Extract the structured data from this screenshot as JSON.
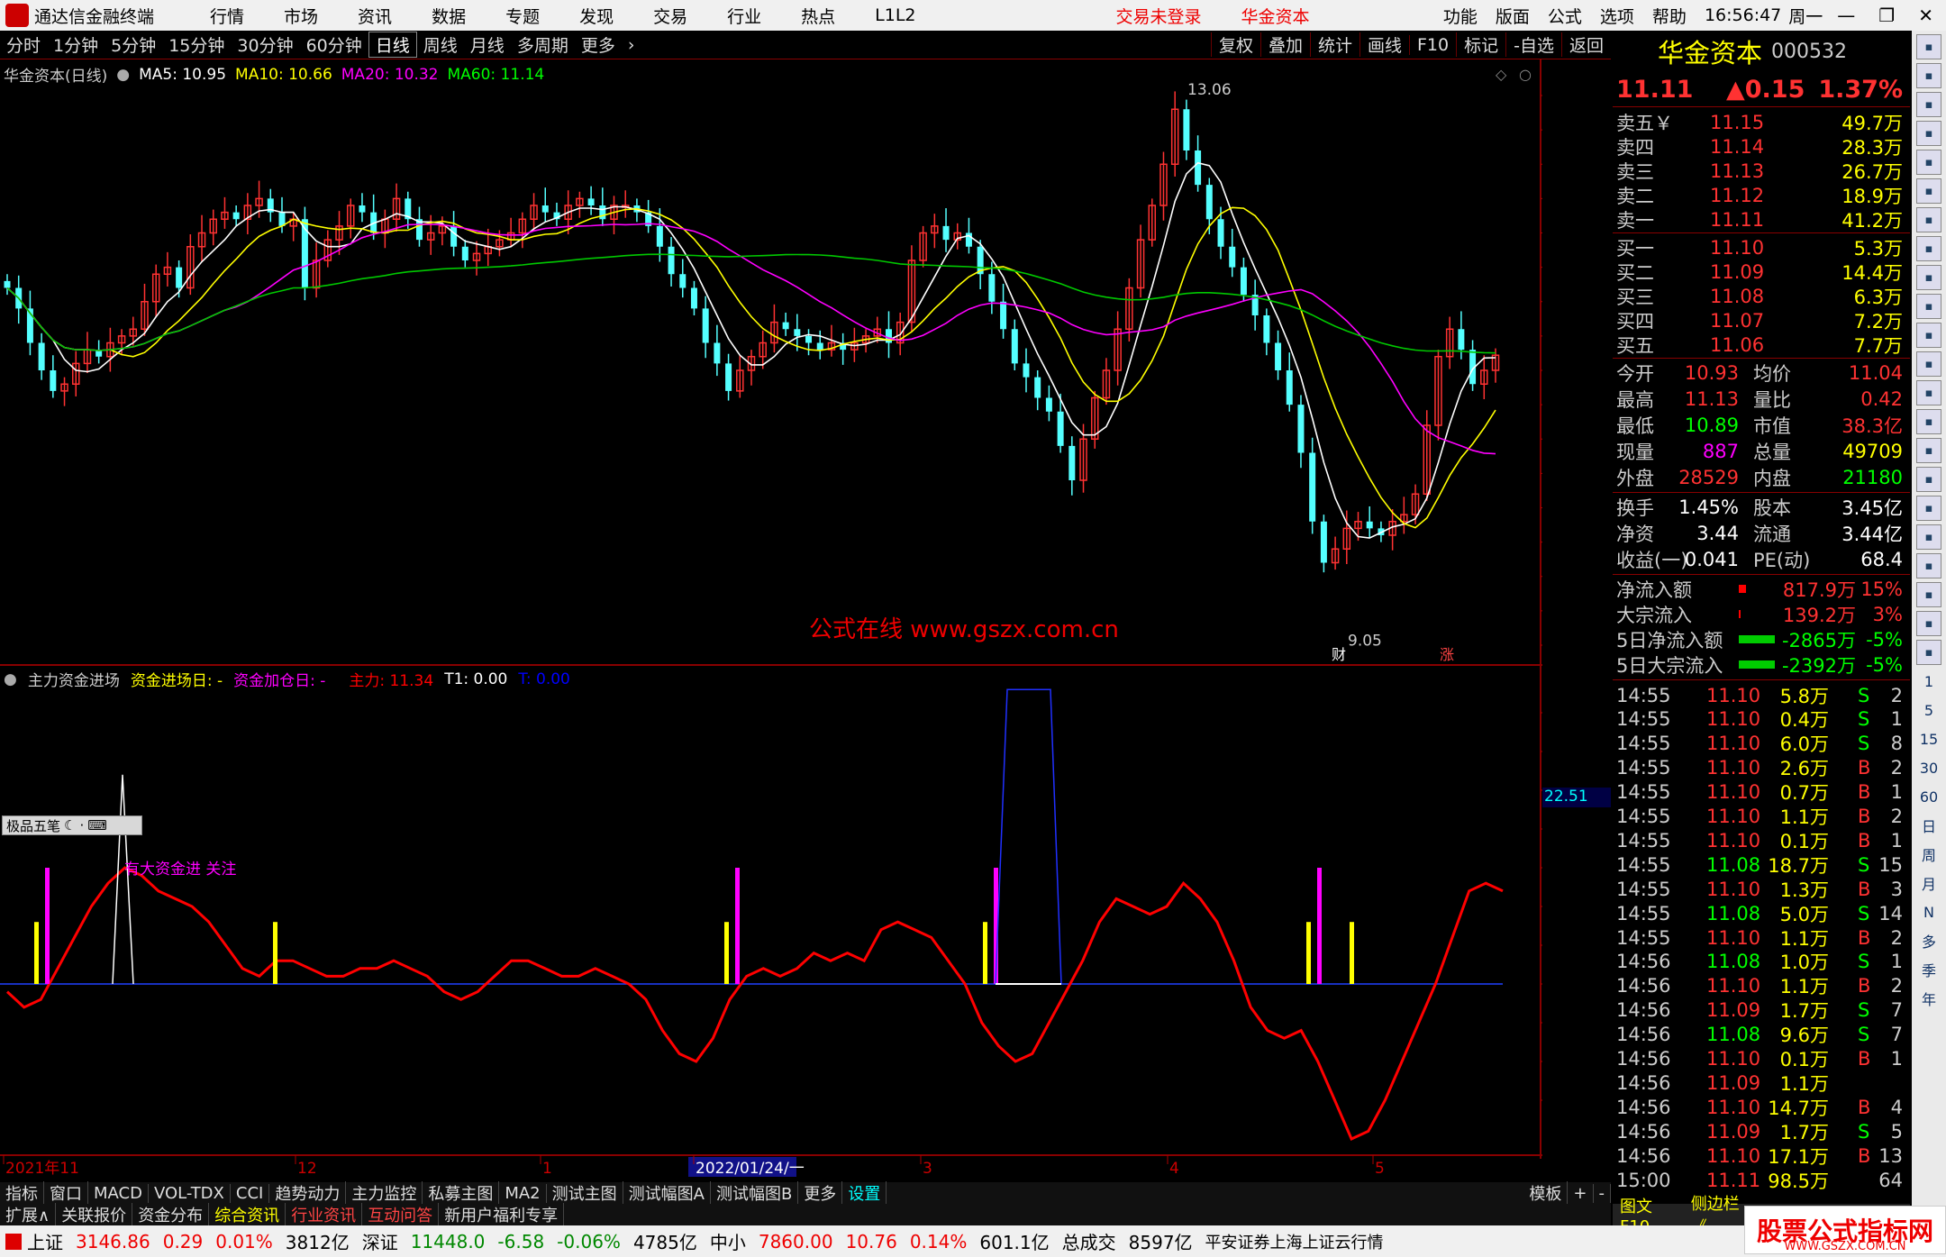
{
  "menubar": {
    "app_name": "通达信金融终端",
    "items": [
      "行情",
      "市场",
      "资讯",
      "数据",
      "专题",
      "发现",
      "交易",
      "行业",
      "热点",
      "L1L2"
    ],
    "login": "交易未登录",
    "broker": "华金资本",
    "right_items": [
      "功能",
      "版面",
      "公式",
      "选项",
      "帮助"
    ],
    "time": "16:56:47",
    "weekday": "周一"
  },
  "periodbar": {
    "items": [
      "分时",
      "1分钟",
      "5分钟",
      "15分钟",
      "30分钟",
      "60分钟",
      "日线",
      "周线",
      "月线",
      "多周期",
      "更多"
    ],
    "active": "日线",
    "right": [
      "复权",
      "叠加",
      "统计",
      "画线",
      "F10",
      "标记",
      "-自选",
      "返回"
    ]
  },
  "stock": {
    "name": "华金资本",
    "code": "000532"
  },
  "ma": {
    "title": "华金资本(日线)",
    "ma5": "MA5: 10.95",
    "ma10": "MA10: 10.66",
    "ma20": "MA20: 10.32",
    "ma60": "MA60: 11.14",
    "colors": {
      "ma5": "#ffffff",
      "ma10": "#ffff00",
      "ma20": "#ff00ff",
      "ma60": "#00ff00"
    }
  },
  "indicator": {
    "name": "主力资金进场",
    "l1": "资金进场日: -",
    "l2": "资金加仓日: -",
    "l3": "主力: 11.34",
    "l4": "T1: 0.00",
    "l5": "T: 0.00",
    "note": "有大资金进 关注",
    "scale_label": "22.51"
  },
  "watermark": "公式在线  www.gszx.com.cn",
  "chart_data": [
    {
      "type": "candlestick",
      "title": "华金资本(日线)",
      "price_axis": [
        "13.00",
        "12.75",
        "12.50",
        "12.25",
        "12.00",
        "11.75",
        "11.50",
        "11.25",
        "11.00",
        "10.75",
        "10.50",
        "10.25",
        "10.00",
        "9.75",
        "9.50",
        "9.25",
        "9.00"
      ],
      "high_label": "13.06",
      "low_label": "9.05",
      "markers": [
        "财",
        "涨"
      ],
      "x_labels": [
        "2021年11",
        "12",
        "1",
        "2022/01/24/一",
        "3",
        "4",
        "5",
        "日线"
      ]
    },
    {
      "type": "line",
      "title": "主力资金进场",
      "y_axis": [
        "35.00",
        "30.00",
        "25.00",
        "20.00",
        "15.00",
        "10.00",
        "5.00",
        "0.00",
        "-5.00",
        "-10.00",
        "-15.00"
      ],
      "color": "#ff0000"
    }
  ],
  "quote": {
    "price": "11.11",
    "change": "▲0.15",
    "pct": "1.37%",
    "asks": [
      [
        "卖五￥",
        "11.15",
        "49.7万"
      ],
      [
        "卖四",
        "11.14",
        "28.3万"
      ],
      [
        "卖三",
        "11.13",
        "26.7万"
      ],
      [
        "卖二",
        "11.12",
        "18.9万"
      ],
      [
        "卖一",
        "11.11",
        "41.2万"
      ]
    ],
    "bids": [
      [
        "买一",
        "11.10",
        "5.3万"
      ],
      [
        "买二",
        "11.09",
        "14.4万"
      ],
      [
        "买三",
        "11.08",
        "6.3万"
      ],
      [
        "买四",
        "11.07",
        "7.2万"
      ],
      [
        "买五",
        "11.06",
        "7.7万"
      ]
    ],
    "stats": [
      [
        "今开",
        "10.93",
        "均价",
        "11.04"
      ],
      [
        "最高",
        "11.13",
        "量比",
        "0.42"
      ],
      [
        "最低",
        "10.89",
        "市值",
        "38.3亿"
      ],
      [
        "现量",
        "887",
        "总量",
        "49709"
      ],
      [
        "外盘",
        "28529",
        "内盘",
        "21180"
      ]
    ],
    "stats2": [
      [
        "换手",
        "1.45%",
        "股本",
        "3.45亿"
      ],
      [
        "净资",
        "3.44",
        "流通",
        "3.44亿"
      ],
      [
        "收益(一)",
        "0.041",
        "PE(动)",
        "68.4"
      ]
    ],
    "flow": [
      [
        "净流入额",
        "817.9万",
        "15%"
      ],
      [
        "大宗流入",
        "139.2万",
        "3%"
      ],
      [
        "5日净流入额",
        "-2865万",
        "-5%"
      ],
      [
        "5日大宗流入",
        "-2392万",
        "-5%"
      ]
    ],
    "ticks": [
      [
        "14:55",
        "11.10",
        "5.8万",
        "S",
        "2"
      ],
      [
        "14:55",
        "11.10",
        "0.4万",
        "S",
        "1"
      ],
      [
        "14:55",
        "11.10",
        "6.0万",
        "S",
        "8"
      ],
      [
        "14:55",
        "11.10",
        "2.6万",
        "B",
        "2"
      ],
      [
        "14:55",
        "11.10",
        "0.7万",
        "B",
        "1"
      ],
      [
        "14:55",
        "11.10",
        "1.1万",
        "B",
        "2"
      ],
      [
        "14:55",
        "11.10",
        "0.1万",
        "B",
        "1"
      ],
      [
        "14:55",
        "11.08",
        "18.7万",
        "S",
        "15"
      ],
      [
        "14:55",
        "11.10",
        "1.3万",
        "B",
        "3"
      ],
      [
        "14:55",
        "11.08",
        "5.0万",
        "S",
        "14"
      ],
      [
        "14:55",
        "11.10",
        "1.1万",
        "B",
        "2"
      ],
      [
        "14:56",
        "11.08",
        "1.0万",
        "S",
        "1"
      ],
      [
        "14:56",
        "11.10",
        "1.1万",
        "B",
        "2"
      ],
      [
        "14:56",
        "11.09",
        "1.7万",
        "S",
        "7"
      ],
      [
        "14:56",
        "11.08",
        "9.6万",
        "S",
        "7"
      ],
      [
        "14:56",
        "11.10",
        "0.1万",
        "B",
        "1"
      ],
      [
        "14:56",
        "11.09",
        "1.1万",
        "",
        ""
      ],
      [
        "14:56",
        "11.10",
        "14.7万",
        "B",
        "4"
      ],
      [
        "14:56",
        "11.09",
        "1.7万",
        "S",
        "5"
      ],
      [
        "14:56",
        "11.10",
        "17.1万",
        "B",
        "13"
      ],
      [
        "15:00",
        "11.11",
        "98.5万",
        "",
        "64"
      ]
    ]
  },
  "tabbar1": [
    "指标",
    "窗口",
    "MACD",
    "VOL-TDX",
    "CCI",
    "趋势动力",
    "主力监控",
    "私募主图",
    "MA2",
    "测试主图",
    "测试幅图A",
    "测试幅图B",
    "更多",
    "设置"
  ],
  "tabbar1_right": [
    "模板",
    "+",
    "-"
  ],
  "tabbar2": [
    "扩展∧",
    "关联报价",
    "资金分布",
    "综合资讯",
    "行业资讯",
    "互动问答",
    "新用户福利专享"
  ],
  "rpbottom": [
    "图文F10",
    "侧边栏《",
    "笔",
    "价",
    "细",
    "强",
    "势"
  ],
  "statusbar": {
    "sh_label": "上证",
    "sh": "3146.86",
    "sh_chg": "0.29",
    "sh_pct": "0.01%",
    "sh_amt": "3812亿",
    "sz_label": "深证",
    "sz": "11448.0",
    "sz_chg": "-6.58",
    "sz_pct": "-0.06%",
    "sz_amt": "4785亿",
    "zx_label": "中小",
    "zx": "7860.00",
    "zx_chg": "10.76",
    "zx_pct": "0.14%",
    "zx_amt": "601.1亿",
    "total_label": "总成交",
    "total": "8597亿",
    "source": "平安证券上海上证云行情"
  },
  "watermark2": "股票公式指标网",
  "watermark2_sub": "WWW.GSZX.COM.CN",
  "toolwin": "极品五笔",
  "vtools_text": [
    "日",
    "周",
    "月",
    "N",
    "多",
    "季",
    "年"
  ],
  "vtools_num": [
    "1",
    "5",
    "15",
    "30",
    "60"
  ]
}
